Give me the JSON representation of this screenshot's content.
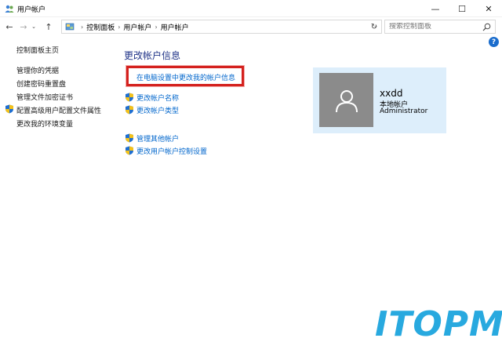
{
  "window": {
    "title": "用户帐户",
    "controls": {
      "minimize": "—",
      "maximize": "☐",
      "close": "✕"
    }
  },
  "address": {
    "crumbs": [
      "控制面板",
      "用户帐户",
      "用户帐户"
    ],
    "search_placeholder": "搜索控制面板"
  },
  "sidebar": {
    "items": [
      {
        "label": "控制面板主页",
        "shield": false
      },
      {
        "label": "管理你的凭据",
        "shield": false
      },
      {
        "label": "创建密码重置盘",
        "shield": false
      },
      {
        "label": "管理文件加密证书",
        "shield": false
      },
      {
        "label": "配置高级用户配置文件属性",
        "shield": true
      },
      {
        "label": "更改我的环境变量",
        "shield": false
      }
    ]
  },
  "main": {
    "heading": "更改帐户信息",
    "pc_settings_link": "在电脑设置中更改我的帐户信息",
    "links": [
      {
        "label": "更改帐户名称",
        "shield": true
      },
      {
        "label": "更改帐户类型",
        "shield": true
      },
      {
        "label": "管理其他帐户",
        "shield": true
      },
      {
        "label": "更改用户帐户控制设置",
        "shield": true
      }
    ]
  },
  "account": {
    "name": "xxdd",
    "type": "本地帐户",
    "role": "Administrator"
  },
  "watermark": "ITOPM",
  "colors": {
    "link": "#0066cc",
    "heading": "#1e3287",
    "highlight": "#d4211e",
    "card_bg": "#ddeefb",
    "avatar_bg": "#8b8b8b",
    "watermark": "#28a9df"
  },
  "icons": {
    "back": "arrow-left-icon",
    "forward": "arrow-right-icon",
    "up": "arrow-up-icon",
    "refresh": "refresh-icon",
    "search": "search-icon",
    "help": "help-icon",
    "shield": "uac-shield-icon",
    "user": "user-silhouette-icon"
  }
}
